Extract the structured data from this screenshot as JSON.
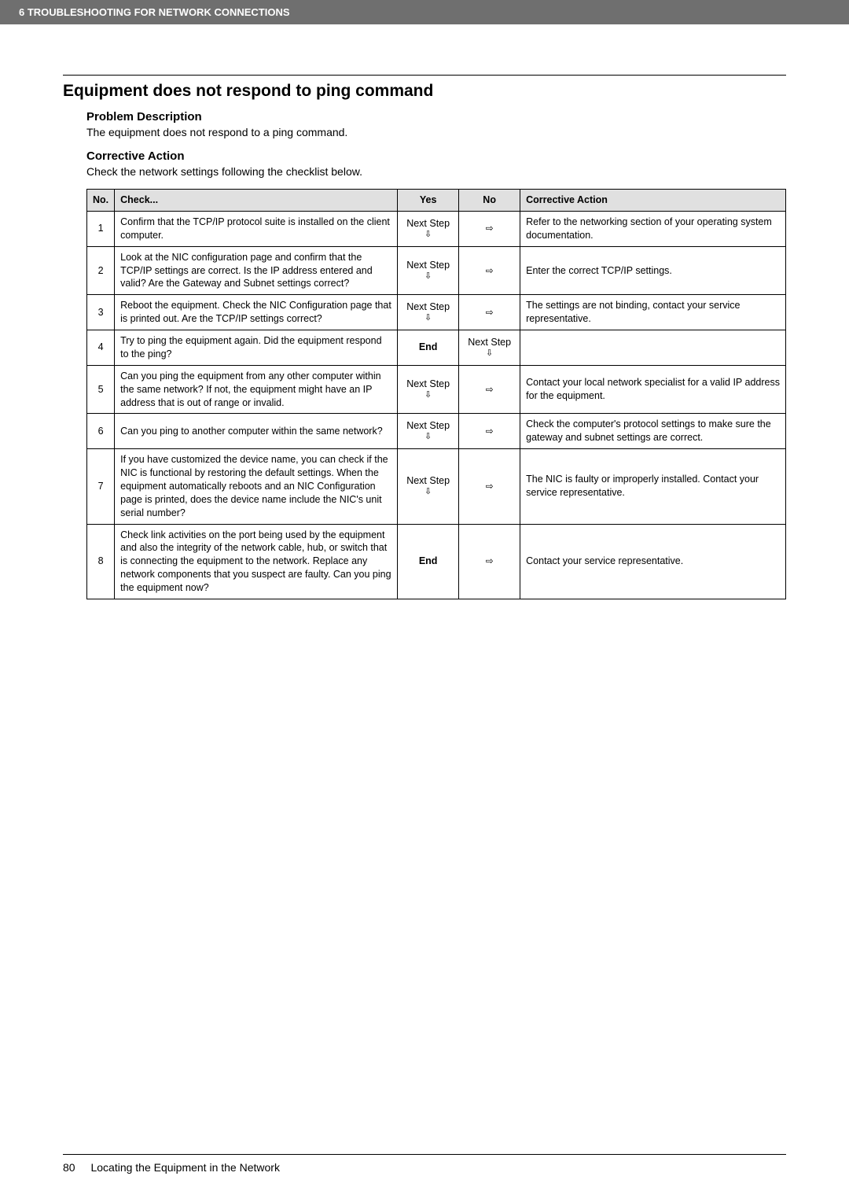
{
  "header": {
    "breadcrumb": "6 TROUBLESHOOTING FOR NETWORK CONNECTIONS"
  },
  "section": {
    "title": "Equipment does not respond to ping command",
    "problem_heading": "Problem Description",
    "problem_text": "The equipment does not respond to a ping command.",
    "corrective_heading": "Corrective Action",
    "corrective_text": "Check the network settings following the checklist below."
  },
  "table": {
    "headers": {
      "no": "No.",
      "check": "Check...",
      "yes": "Yes",
      "noh": "No",
      "action": "Corrective Action"
    },
    "next_step_label": "Next Step",
    "end_label": "End",
    "rows": [
      {
        "no": "1",
        "check": "Confirm that the TCP/IP protocol suite is installed on the client computer.",
        "yes_type": "next",
        "no_type": "arrow",
        "action": "Refer to the networking section of your operating system documentation."
      },
      {
        "no": "2",
        "check": "Look at the NIC configuration page and confirm that the TCP/IP settings are correct. Is the IP address entered and valid? Are the Gateway and Subnet settings correct?",
        "yes_type": "next",
        "no_type": "arrow",
        "action": "Enter the correct TCP/IP settings."
      },
      {
        "no": "3",
        "check": "Reboot the equipment. Check the NIC Configuration page that is printed out. Are the TCP/IP settings correct?",
        "yes_type": "next",
        "no_type": "arrow",
        "action": "The settings are not binding, contact your service representative."
      },
      {
        "no": "4",
        "check": "Try to ping the equipment again. Did the equipment respond to the ping?",
        "yes_type": "end",
        "no_type": "next",
        "action": ""
      },
      {
        "no": "5",
        "check": "Can you ping the equipment from any other computer within the same network? If not, the equipment might have an IP address that is out of range or invalid.",
        "yes_type": "next",
        "no_type": "arrow",
        "action": "Contact your local network specialist for a valid IP address for the equipment."
      },
      {
        "no": "6",
        "check": "Can you ping to another computer within the same network?",
        "yes_type": "next",
        "no_type": "arrow",
        "action": "Check the computer's protocol settings to make sure the gateway and subnet settings are correct."
      },
      {
        "no": "7",
        "check": "If you have customized the device name, you can check if the NIC is functional by restoring the default settings. When the equipment automatically reboots and an NIC Configuration page is printed, does the device name include the NIC's unit serial number?",
        "yes_type": "next",
        "no_type": "arrow",
        "action": "The NIC is faulty or improperly installed. Contact your service representative."
      },
      {
        "no": "8",
        "check": "Check link activities on the port being used by the equipment and also the integrity of the network cable, hub, or switch that is connecting the equipment to the network. Replace any network components that you suspect are faulty. Can you ping the equipment now?",
        "yes_type": "end",
        "no_type": "arrow",
        "action": "Contact your service representative."
      }
    ]
  },
  "footer": {
    "page_number": "80",
    "footer_text": "Locating the Equipment in the Network"
  }
}
